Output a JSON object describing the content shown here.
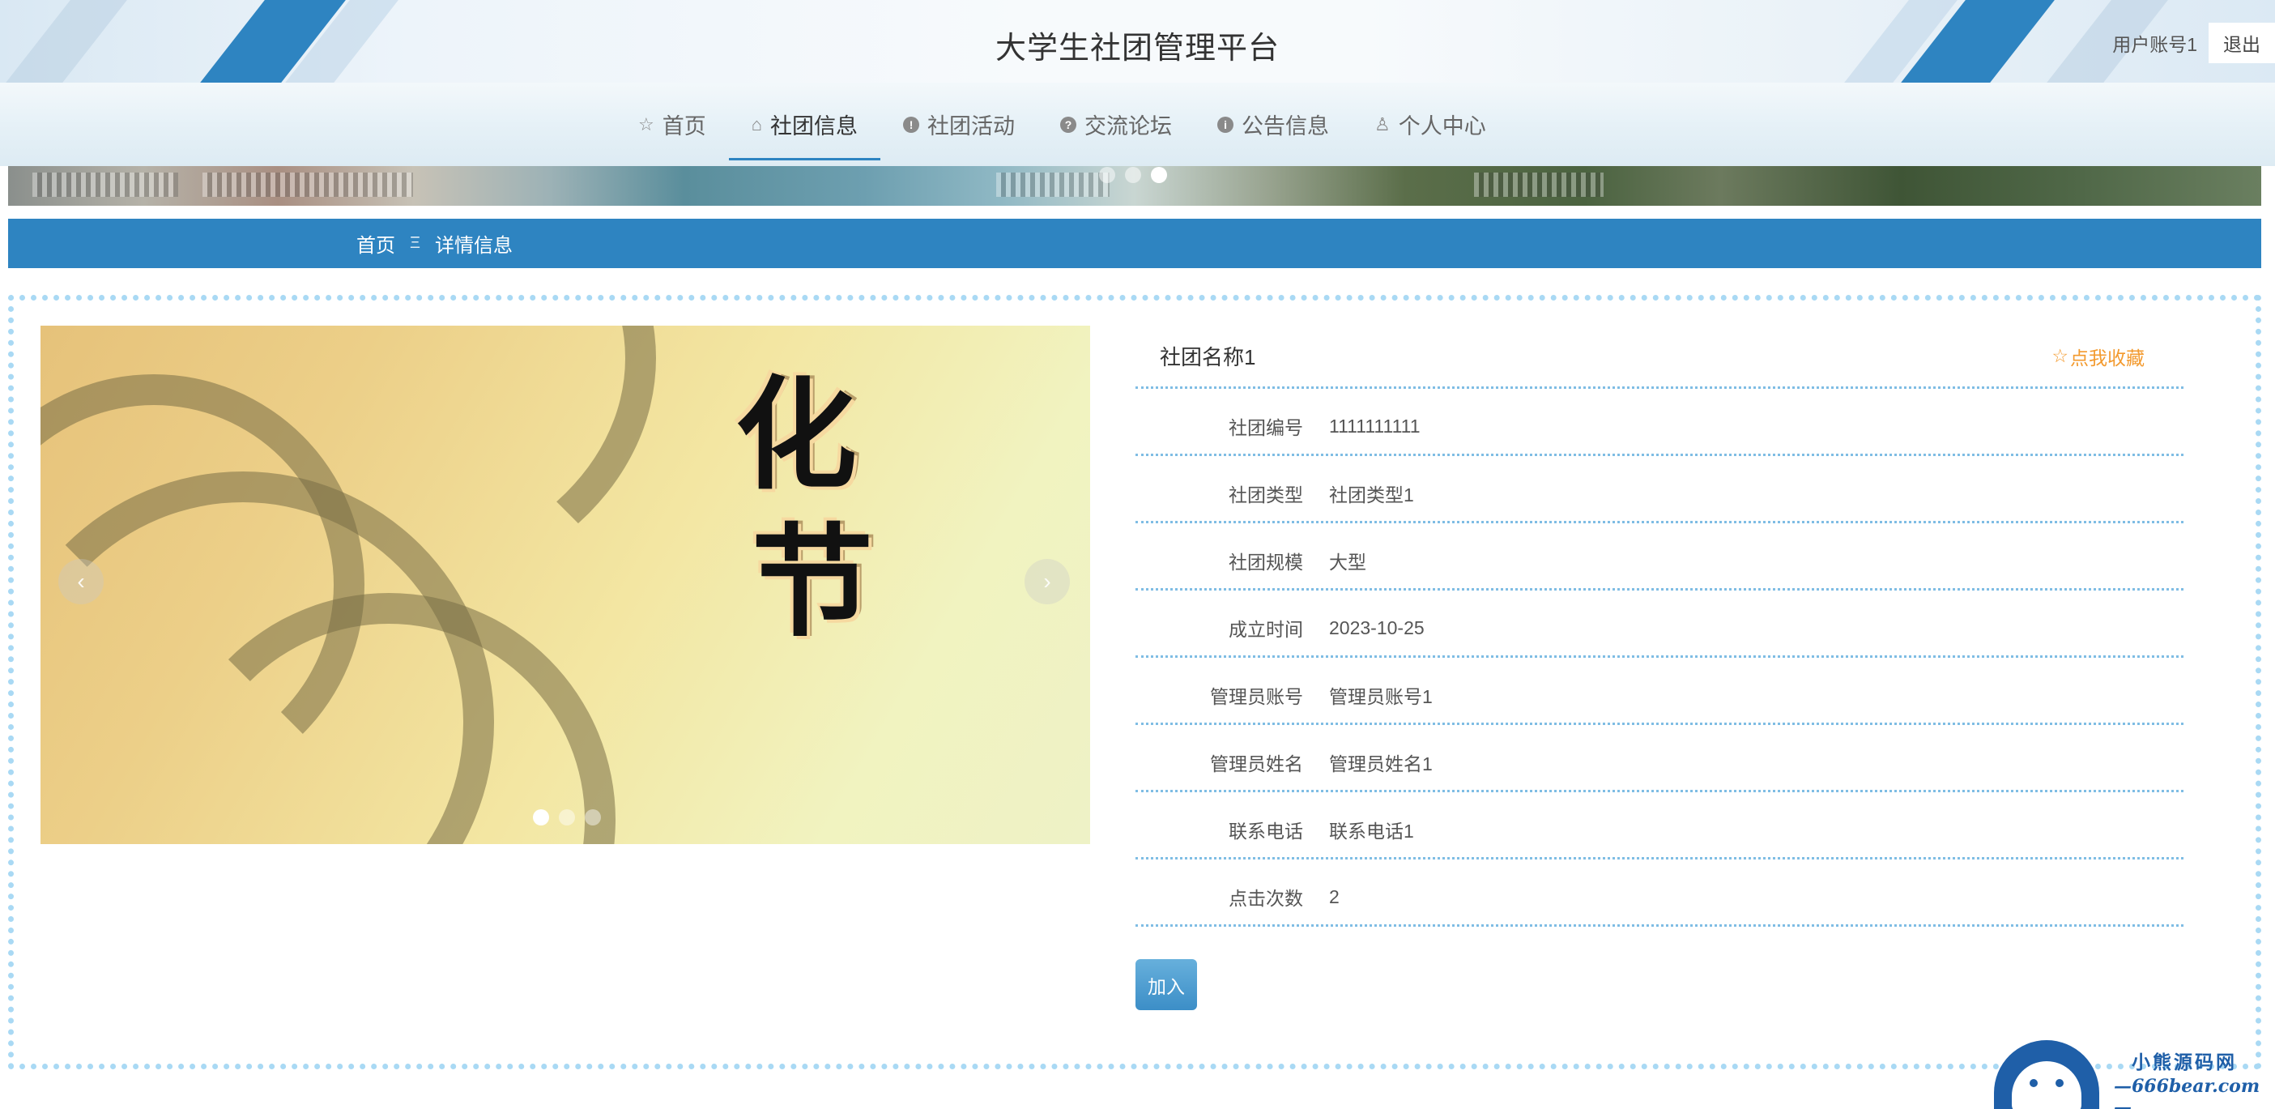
{
  "header": {
    "title": "大学生社团管理平台",
    "user": "用户账号1",
    "logout": "退出"
  },
  "nav": [
    {
      "label": "首页",
      "icon": "star-outline-icon",
      "glyph": "☆",
      "active": false
    },
    {
      "label": "社团信息",
      "icon": "bag-icon",
      "glyph": "⌂",
      "active": true
    },
    {
      "label": "社团活动",
      "icon": "exclamation-circle-icon",
      "glyph": "!",
      "active": false
    },
    {
      "label": "交流论坛",
      "icon": "question-circle-icon",
      "glyph": "?",
      "active": false
    },
    {
      "label": "公告信息",
      "icon": "info-circle-icon",
      "glyph": "i",
      "active": false
    },
    {
      "label": "个人中心",
      "icon": "user-icon",
      "glyph": "♙",
      "active": false
    }
  ],
  "banner": {
    "dots": 3,
    "active_dot": 3
  },
  "breadcrumb": {
    "home": "首页",
    "separator": "Ξ",
    "current": "详情信息"
  },
  "gallery": {
    "image_chars": [
      "化",
      "节"
    ],
    "dots": 3,
    "active_dot": 1,
    "prev": "‹",
    "next": "›"
  },
  "detail": {
    "title": "社团名称1",
    "favorite": "点我收藏",
    "favorite_icon": "☆",
    "fields": [
      {
        "label": "社团编号",
        "value": "1111111111"
      },
      {
        "label": "社团类型",
        "value": "社团类型1"
      },
      {
        "label": "社团规模",
        "value": "大型"
      },
      {
        "label": "成立时间",
        "value": "2023-10-25"
      },
      {
        "label": "管理员账号",
        "value": "管理员账号1"
      },
      {
        "label": "管理员姓名",
        "value": "管理员姓名1"
      },
      {
        "label": "联系电话",
        "value": "联系电话1"
      },
      {
        "label": "点击次数",
        "value": "2"
      }
    ],
    "join": "加入"
  },
  "watermark": {
    "line1": "小熊源码网",
    "line2": "—666bear.com—"
  },
  "colors": {
    "primary": "#2e84c1",
    "favorite": "#f39a2e",
    "border_dots": "#a9d9f4"
  }
}
